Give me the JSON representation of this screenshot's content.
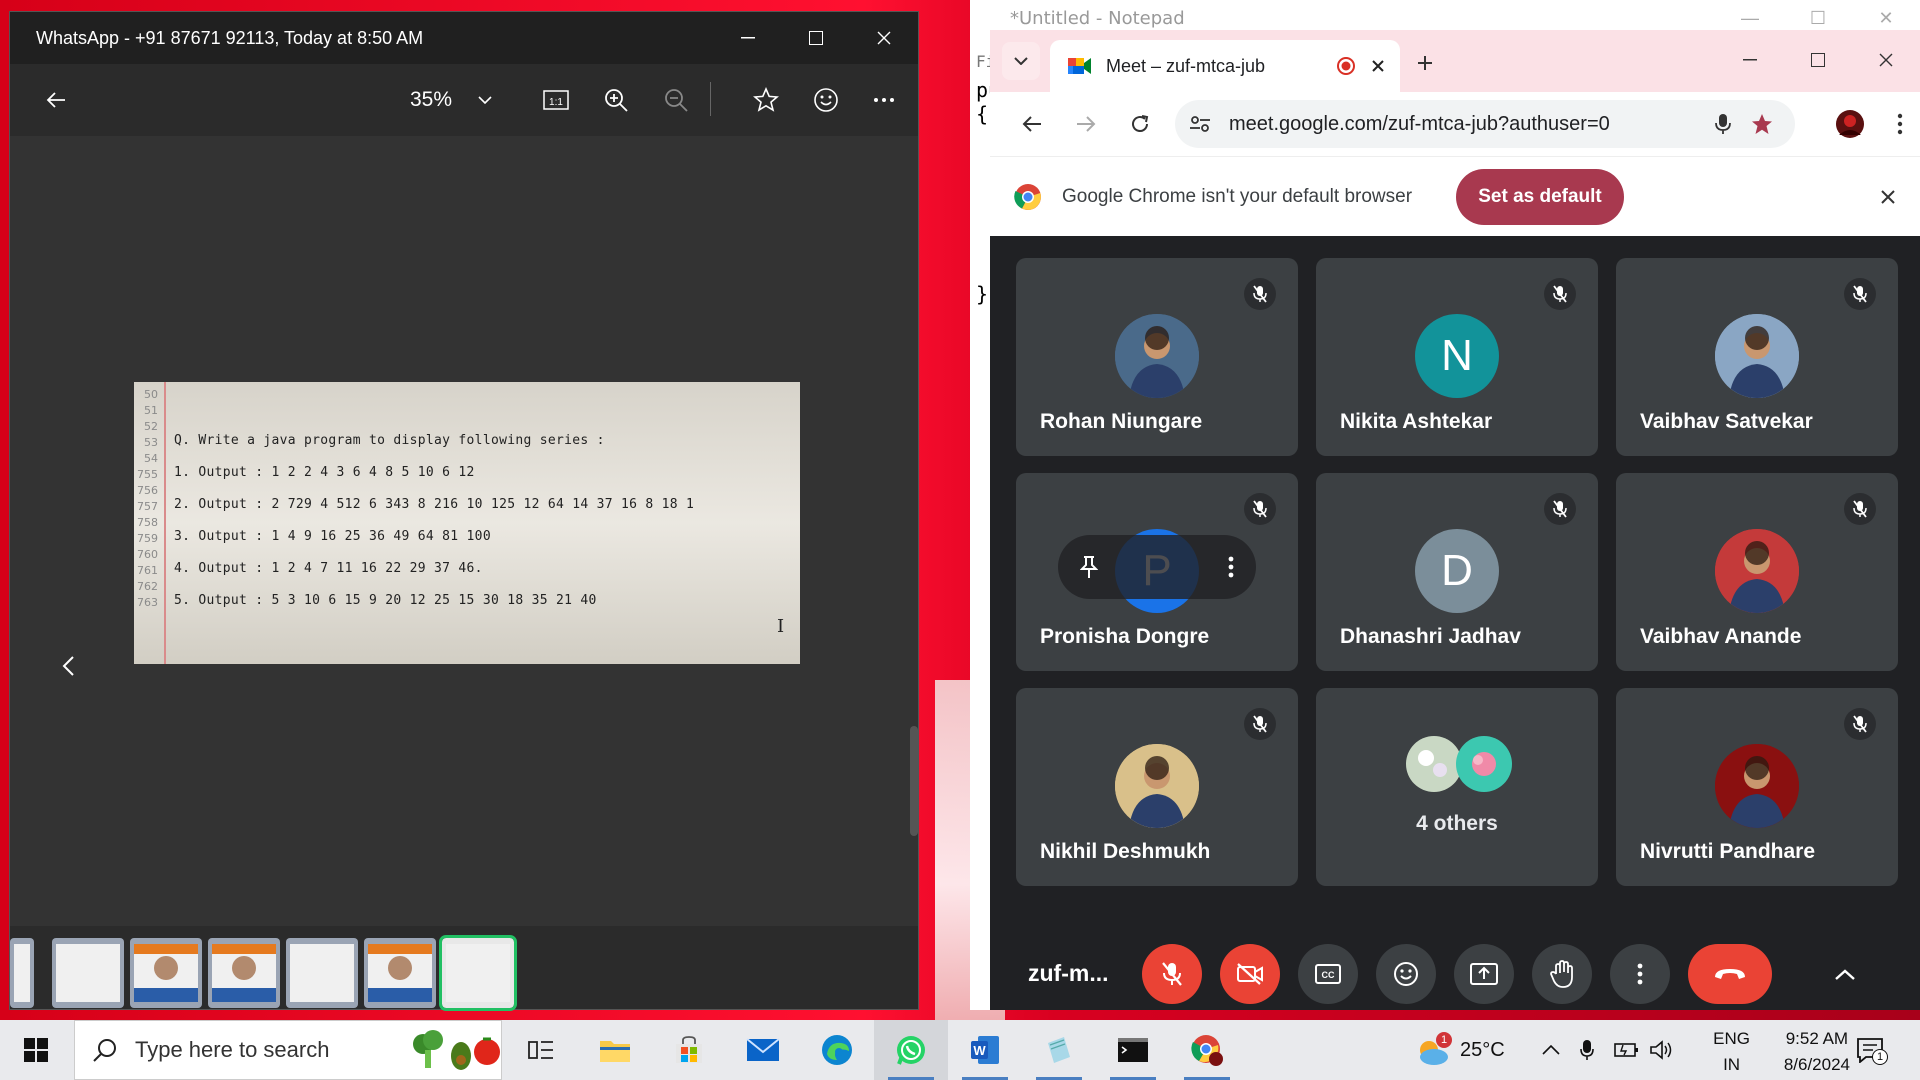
{
  "photos": {
    "title": "WhatsApp - +91 87671 92113, Today at 8:50 AM",
    "zoom": "35%",
    "image_lines": [
      {
        "num": "50",
        "text": ""
      },
      {
        "num": "51",
        "text": ""
      },
      {
        "num": "52",
        "text": ""
      },
      {
        "num": "53",
        "text": "Q. Write a java program to display following series :"
      },
      {
        "num": "54",
        "text": ""
      },
      {
        "num": "755",
        "text": "1. Output :  1  2  2  4  3  6  4  8  5  10  6  12"
      },
      {
        "num": "756",
        "text": ""
      },
      {
        "num": "757",
        "text": "2. Output :  2  729  4  512  6  343  8  216  10  125  12  64  14  37  16  8  18  1"
      },
      {
        "num": "758",
        "text": ""
      },
      {
        "num": "759",
        "text": "3. Output :  1  4  9  16  25  36  49  64  81  100"
      },
      {
        "num": "760",
        "text": ""
      },
      {
        "num": "761",
        "text": "4. Output :  1  2  4  7  11  16  22  29  37  46."
      },
      {
        "num": "762",
        "text": ""
      },
      {
        "num": "763",
        "text": "5. Output :  5  3  10  6  15  9  20  12  25  15  30  18  35  21  40"
      }
    ],
    "cursor_glyph": "I",
    "filmstrip_count": 7
  },
  "notepad": {
    "title": "*Untitled - Notepad",
    "menu_stub": "Fi",
    "lines": [
      "pu",
      "{",
      "}"
    ]
  },
  "chrome": {
    "tab_title": "Meet – zuf-mtca-jub",
    "url": "meet.google.com/zuf-mtca-jub?authuser=0",
    "infobar_message": "Google Chrome isn't your default browser",
    "set_default_label": "Set as default"
  },
  "meet": {
    "participants": [
      {
        "name": "Rohan Niungare",
        "avatar": "photo",
        "color": "#4a6a8a"
      },
      {
        "name": "Nikita Ashtekar",
        "avatar": "N",
        "color": "#12939a"
      },
      {
        "name": "Vaibhav Satvekar",
        "avatar": "photo",
        "color": "#8aa6c4"
      },
      {
        "name": "Pronisha Dongre",
        "avatar": "P",
        "color": "#1a73e8"
      },
      {
        "name": "Dhanashri Jadhav",
        "avatar": "D",
        "color": "#7b8e9a"
      },
      {
        "name": "Vaibhav Anande",
        "avatar": "photo",
        "color": "#c43a3a"
      },
      {
        "name": "Nikhil Deshmukh",
        "avatar": "photo",
        "color": "#d9c08a"
      },
      {
        "name": "4 others",
        "avatar": "group",
        "color": "#8aa"
      },
      {
        "name": "Nivrutti Pandhare",
        "avatar": "photo",
        "color": "#8a1010"
      }
    ],
    "meeting_code_short": "zuf-m..."
  },
  "taskbar": {
    "search_placeholder": "Type here to search",
    "weather_temp": "25°C",
    "weather_badge": "1",
    "lang_top": "ENG",
    "lang_bottom": "IN",
    "time": "9:52 AM",
    "date": "8/6/2024",
    "notification_count": "1"
  }
}
